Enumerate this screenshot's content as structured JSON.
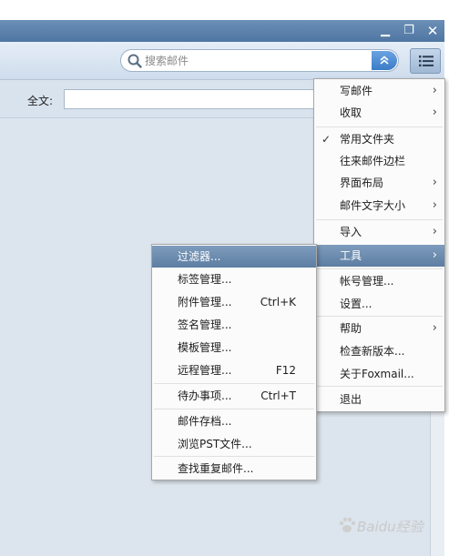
{
  "window": {
    "controls": {
      "minimize": "▁",
      "restore": "❐",
      "close": "✕"
    }
  },
  "toolbar": {
    "search_placeholder": "搜索邮件",
    "expand_glyph": "≈",
    "icons": {
      "search": "search-icon",
      "menu": "list-menu-icon"
    }
  },
  "filter": {
    "fulltext_label": "全文:",
    "fulltext_value": ""
  },
  "main_menu": {
    "items": [
      {
        "label": "写邮件",
        "has_submenu": true
      },
      {
        "label": "收取",
        "has_submenu": true
      },
      {
        "label": "常用文件夹",
        "checked": true
      },
      {
        "label": "往来邮件边栏"
      },
      {
        "label": "界面布局",
        "has_submenu": true
      },
      {
        "label": "邮件文字大小",
        "has_submenu": true
      },
      {
        "label": "导入",
        "has_submenu": true
      },
      {
        "label": "工具",
        "has_submenu": true,
        "active": true
      },
      {
        "label": "帐号管理..."
      },
      {
        "label": "设置..."
      },
      {
        "label": "帮助",
        "has_submenu": true
      },
      {
        "label": "检查新版本..."
      },
      {
        "label": "关于Foxmail..."
      },
      {
        "label": "退出"
      }
    ],
    "submenu_arrow": "›",
    "check_glyph": "✓"
  },
  "tools_submenu": {
    "items": [
      {
        "label": "过滤器...",
        "active": true
      },
      {
        "label": "标签管理..."
      },
      {
        "label": "附件管理...",
        "shortcut": "Ctrl+K"
      },
      {
        "label": "签名管理..."
      },
      {
        "label": "模板管理..."
      },
      {
        "label": "远程管理...",
        "shortcut": "F12"
      },
      {
        "label": "待办事项...",
        "shortcut": "Ctrl+T"
      },
      {
        "label": "邮件存档..."
      },
      {
        "label": "浏览PST文件..."
      },
      {
        "label": "查找重复邮件..."
      }
    ]
  },
  "watermark": {
    "text": "Baidu经验"
  },
  "colors": {
    "accent": "#4f77a3",
    "highlight": "#6b8bb0",
    "menu_bg": "#fbfbfb"
  }
}
